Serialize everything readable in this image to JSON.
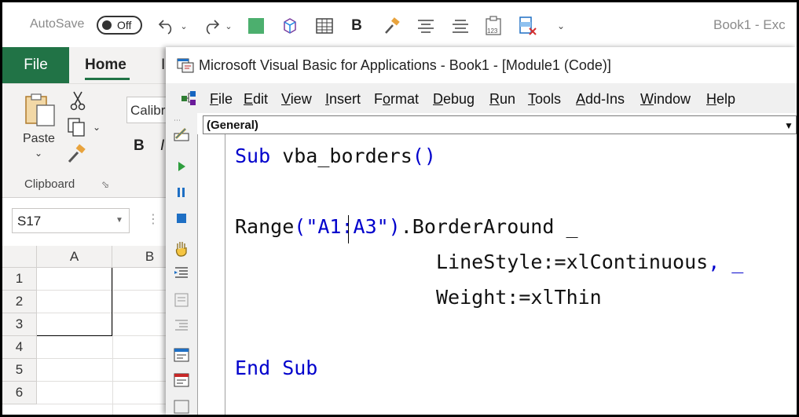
{
  "qat": {
    "autosave_label": "AutoSave",
    "toggle_state": "Off",
    "doc_title": "Book1  -  Exc"
  },
  "ribbon": {
    "tab_file": "File",
    "tab_home": "Home",
    "tab_partial": "I",
    "paste_label": "Paste",
    "clipboard_label": "Clipboard",
    "font_name": "Calibri",
    "bold_label": "B",
    "italic_label": "I"
  },
  "sheet": {
    "name_box": "S17",
    "columns": [
      "A",
      "B"
    ],
    "rows": [
      "1",
      "2",
      "3",
      "4",
      "5",
      "6"
    ]
  },
  "vbe": {
    "title": "Microsoft Visual Basic for Applications - Book1 - [Module1 (Code)]",
    "menu": [
      {
        "label": "File",
        "u": "F",
        "rest": "ile"
      },
      {
        "label": "Edit",
        "u": "E",
        "rest": "dit"
      },
      {
        "label": "View",
        "u": "V",
        "rest": "iew"
      },
      {
        "label": "Insert",
        "u": "I",
        "rest": "nsert"
      },
      {
        "label": "Format",
        "pre": "F",
        "u": "o",
        "rest": "rmat"
      },
      {
        "label": "Debug",
        "u": "D",
        "rest": "ebug"
      },
      {
        "label": "Run",
        "u": "R",
        "rest": "un"
      },
      {
        "label": "Tools",
        "u": "T",
        "rest": "ools"
      },
      {
        "label": "Add-Ins",
        "u": "A",
        "rest": "dd-Ins"
      },
      {
        "label": "Window",
        "u": "W",
        "rest": "indow"
      },
      {
        "label": "Help",
        "u": "H",
        "rest": "elp"
      }
    ],
    "object_combo": "(General)",
    "code": {
      "line1_kw": "Sub",
      "line1_rest": " vba_borders",
      "line1_parens": "()",
      "line2_a": "Range",
      "line2_b": "(\"A1:A3\")",
      "line2_c": ".BorderAround _",
      "line3_a": "LineStyle:=xlContinuous",
      "line3_b": ", _",
      "line4": "Weight:=xlThin",
      "line5_kw": "End Sub"
    }
  },
  "colors": {
    "excel_green": "#217346",
    "keyword_blue": "#0000cc"
  }
}
